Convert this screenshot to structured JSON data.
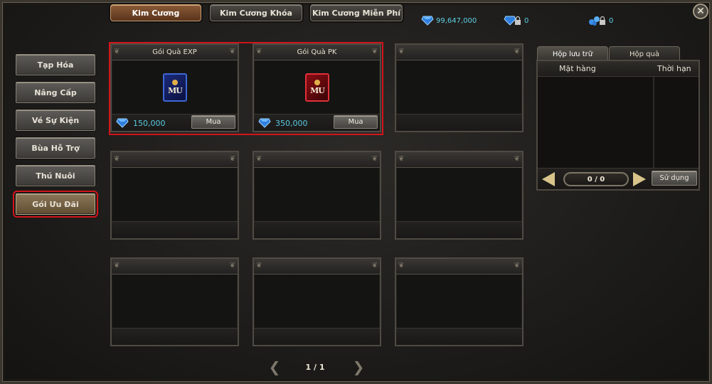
{
  "top_tabs": [
    {
      "label": "Kim Cương",
      "active": true
    },
    {
      "label": "Kim Cương Khóa",
      "active": false
    },
    {
      "label": "Kim Cương Miễn Phí",
      "active": false
    }
  ],
  "currencies": [
    {
      "icon": "diamond-icon",
      "value": "99,647,000"
    },
    {
      "icon": "locked-diamond-icon",
      "value": "0"
    },
    {
      "icon": "locked-free-diamond-icon",
      "value": "0"
    }
  ],
  "side_menu": [
    {
      "label": "Tạp Hóa",
      "active": false
    },
    {
      "label": "Nâng Cấp",
      "active": false
    },
    {
      "label": "Vé Sự Kiện",
      "active": false
    },
    {
      "label": "Bùa Hỗ Trợ",
      "active": false
    },
    {
      "label": "Thú Nuôi",
      "active": false
    },
    {
      "label": "Gói Ưu Đãi",
      "active": true
    }
  ],
  "products": [
    {
      "title": "Gói Quà EXP",
      "icon": "exp-package-icon",
      "price": "150,000",
      "buy_label": "Mua"
    },
    {
      "title": "Gói Quà PK",
      "icon": "pk-package-icon",
      "price": "350,000",
      "buy_label": "Mua"
    }
  ],
  "storage": {
    "tabs": [
      {
        "label": "Hộp lưu trữ",
        "active": true
      },
      {
        "label": "Hộp quà",
        "active": false
      }
    ],
    "col_item": "Mặt hàng",
    "col_expiry": "Thời hạn",
    "page": "0 / 0",
    "use_label": "Sử dụng"
  },
  "pager": {
    "label": "1 / 1"
  },
  "colors": {
    "highlight": "#d1141b",
    "price_text": "#58c8e0",
    "active_tab": "#8a5b38"
  }
}
